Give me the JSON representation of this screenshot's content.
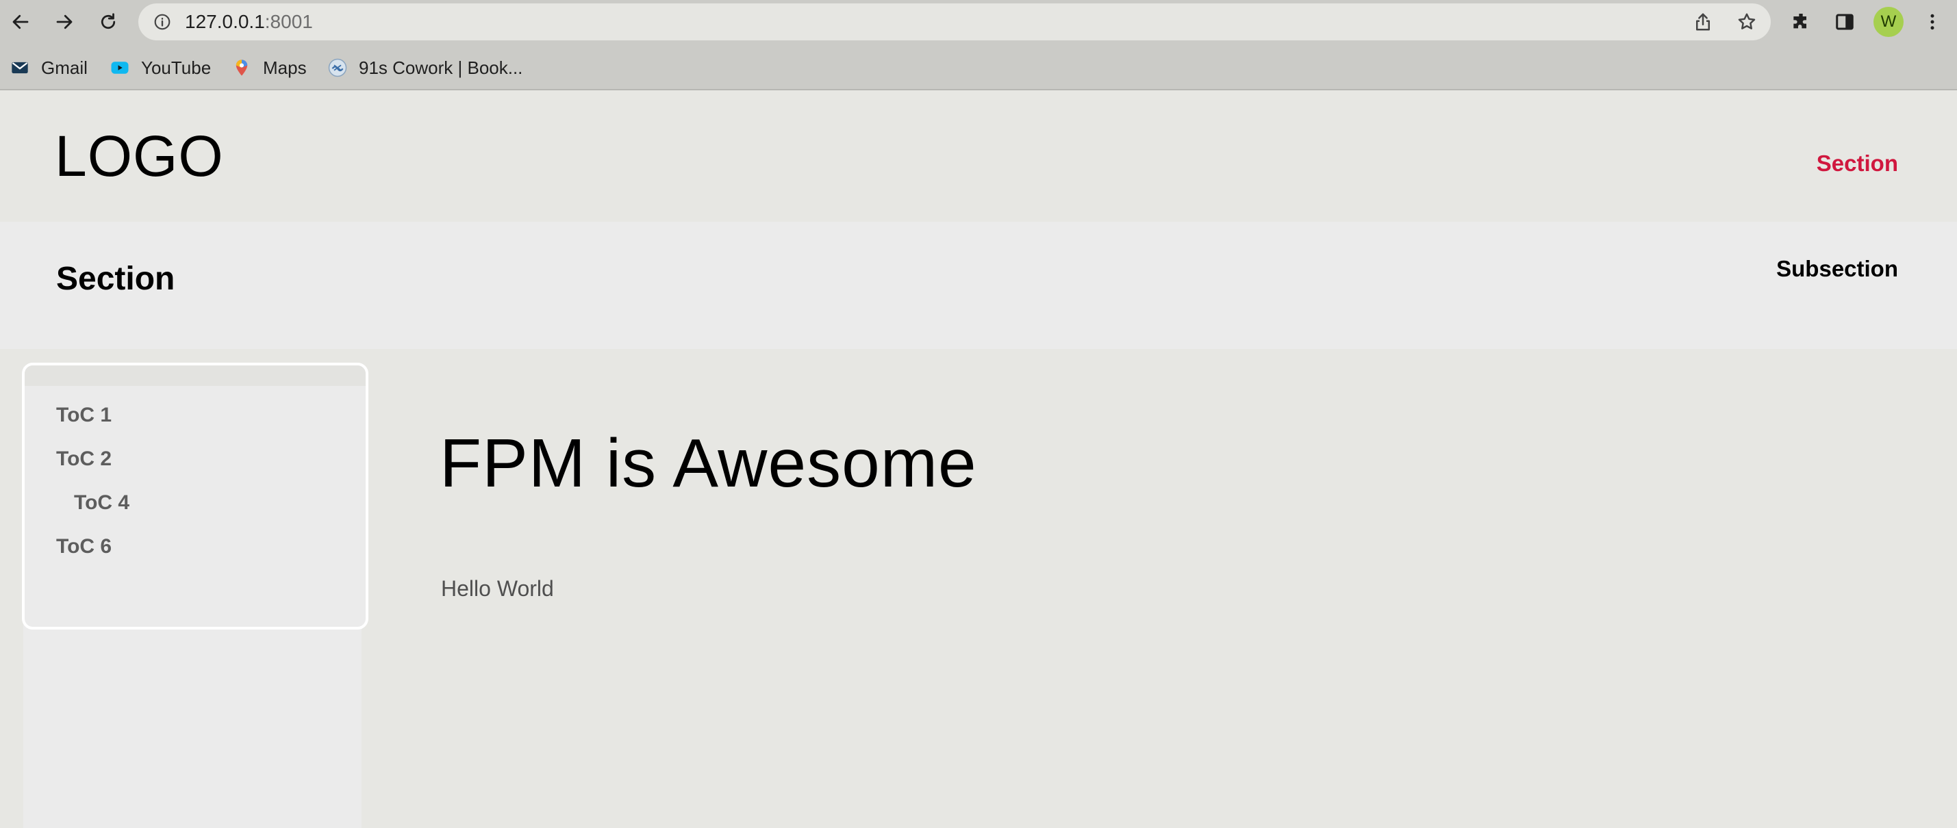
{
  "browser": {
    "url_host": "127.0.0.1",
    "url_port": ":8001",
    "avatar_letter": "W",
    "icons": [
      "back-arrow-icon",
      "forward-arrow-icon",
      "reload-icon",
      "info-icon",
      "share-icon",
      "star-icon",
      "extensions-icon",
      "side-panel-icon",
      "more-menu-icon"
    ]
  },
  "bookmarks": [
    {
      "label": "Gmail",
      "icon": "gmail-icon"
    },
    {
      "label": "YouTube",
      "icon": "youtube-icon"
    },
    {
      "label": "Maps",
      "icon": "maps-icon"
    },
    {
      "label": "91s Cowork | Book...",
      "icon": "cowork-icon"
    }
  ],
  "header": {
    "logo": "LOGO",
    "nav_link": "Section",
    "accent": "#d0173e"
  },
  "subheader": {
    "title": "Section",
    "link": "Subsection"
  },
  "toc": {
    "items": [
      {
        "label": "ToC 1"
      },
      {
        "label": "ToC 2"
      },
      {
        "label": "ToC 4"
      },
      {
        "label": "ToC 6"
      }
    ]
  },
  "main": {
    "title": "FPM is Awesome",
    "body": "Hello World"
  }
}
